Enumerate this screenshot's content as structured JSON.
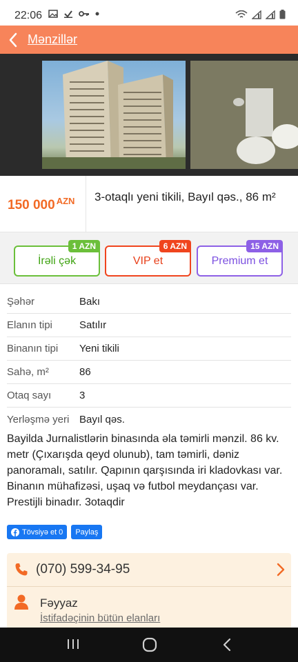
{
  "status": {
    "time": "22:06"
  },
  "header": {
    "title": "Mənzillər"
  },
  "listing": {
    "price": "150 000",
    "currency": "AZN",
    "title": "3-otaqlı yeni tikili, Bayıl qəs., 86 m²"
  },
  "actions": [
    {
      "label": "İrəli çək",
      "badge": "1 AZN"
    },
    {
      "label": "VIP et",
      "badge": "6 AZN"
    },
    {
      "label": "Premium et",
      "badge": "15 AZN"
    }
  ],
  "properties": [
    {
      "key": "Şəhər",
      "value": "Bakı"
    },
    {
      "key": "Elanın tipi",
      "value": "Satılır"
    },
    {
      "key": "Binanın tipi",
      "value": "Yeni tikili"
    },
    {
      "key": "Sahə, m²",
      "value": "86"
    },
    {
      "key": "Otaq sayı",
      "value": "3"
    },
    {
      "key": "Yerləşmə yeri",
      "value": "Bayıl qəs."
    }
  ],
  "description": "Bayilda Jurnalistlərin binasında əla təmirli mənzil. 86 kv. metr (Çıxarışda qeyd olunub), tam təmirli, dəniz panoramalı, satılır. Qapının qarşısında iri kladovkası var. Binanın mühafizəsi, uşaq və futbol meydançası var. Prestijli binadır. 3otaqdir",
  "social": {
    "recommend": "Tövsiyə et 0",
    "share": "Paylaş"
  },
  "contact": {
    "phone": "(070) 599-34-95",
    "name": "Fəyyaz",
    "all_ads": "İstifadəçinin bütün elanları"
  },
  "colors": {
    "brand": "#f7845a",
    "price": "#f26a25"
  }
}
